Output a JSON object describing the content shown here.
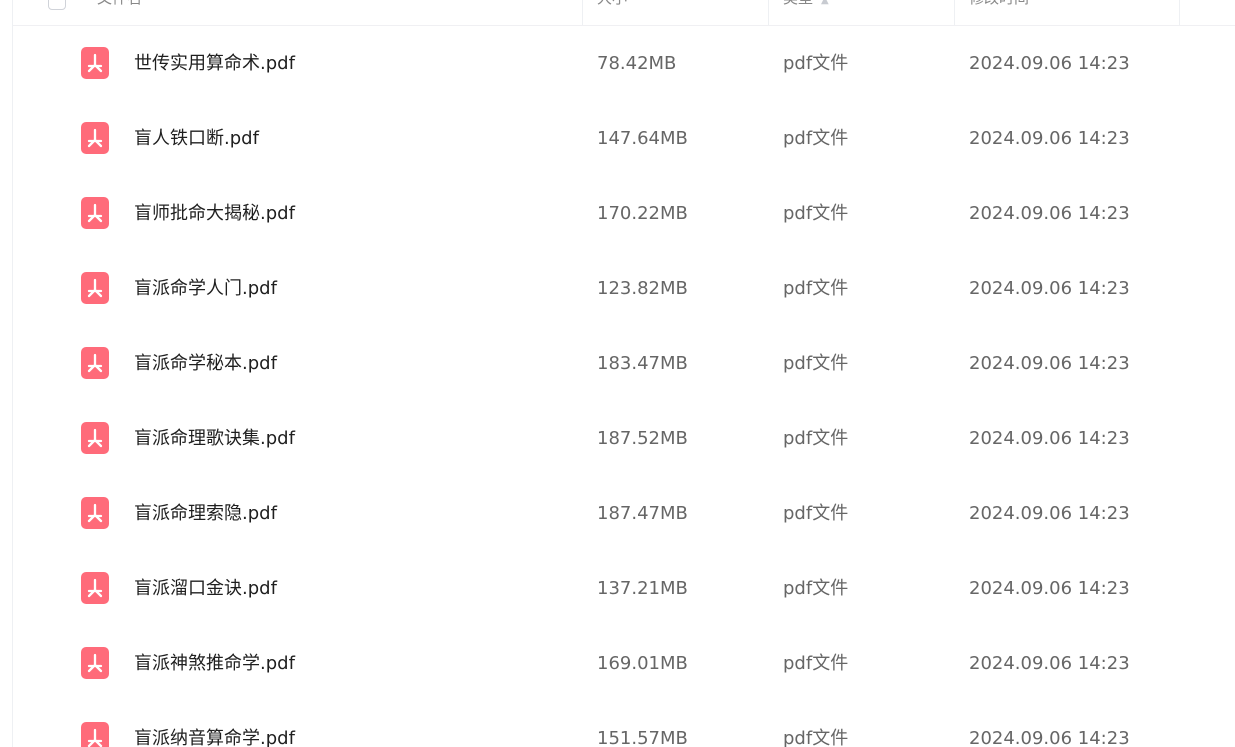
{
  "header": {
    "name": "文件名",
    "size": "大小",
    "type": "类型",
    "modified": "修改时间"
  },
  "files": [
    {
      "name": "世传实用算命术.pdf",
      "size": "78.42MB",
      "type": "pdf文件",
      "time": "2024.09.06 14:23",
      "icon": "pdf-icon"
    },
    {
      "name": "盲人铁口断.pdf",
      "size": "147.64MB",
      "type": "pdf文件",
      "time": "2024.09.06 14:23",
      "icon": "pdf-icon"
    },
    {
      "name": "盲师批命大揭秘.pdf",
      "size": "170.22MB",
      "type": "pdf文件",
      "time": "2024.09.06 14:23",
      "icon": "pdf-icon"
    },
    {
      "name": "盲派命学人门.pdf",
      "size": "123.82MB",
      "type": "pdf文件",
      "time": "2024.09.06 14:23",
      "icon": "pdf-icon"
    },
    {
      "name": "盲派命学秘本.pdf",
      "size": "183.47MB",
      "type": "pdf文件",
      "time": "2024.09.06 14:23",
      "icon": "pdf-icon"
    },
    {
      "name": "盲派命理歌诀集.pdf",
      "size": "187.52MB",
      "type": "pdf文件",
      "time": "2024.09.06 14:23",
      "icon": "pdf-icon"
    },
    {
      "name": "盲派命理索隐.pdf",
      "size": "187.47MB",
      "type": "pdf文件",
      "time": "2024.09.06 14:23",
      "icon": "pdf-icon"
    },
    {
      "name": "盲派溜口金诀.pdf",
      "size": "137.21MB",
      "type": "pdf文件",
      "time": "2024.09.06 14:23",
      "icon": "pdf-icon"
    },
    {
      "name": "盲派神煞推命学.pdf",
      "size": "169.01MB",
      "type": "pdf文件",
      "time": "2024.09.06 14:23",
      "icon": "pdf-icon"
    },
    {
      "name": "盲派纳音算命学.pdf",
      "size": "151.57MB",
      "type": "pdf文件",
      "time": "2024.09.06 14:23",
      "icon": "pdf-icon"
    }
  ],
  "colors": {
    "pdf_icon": "#ff6b7a",
    "name_text": "#1f1f1f",
    "meta_text": "#666666"
  }
}
